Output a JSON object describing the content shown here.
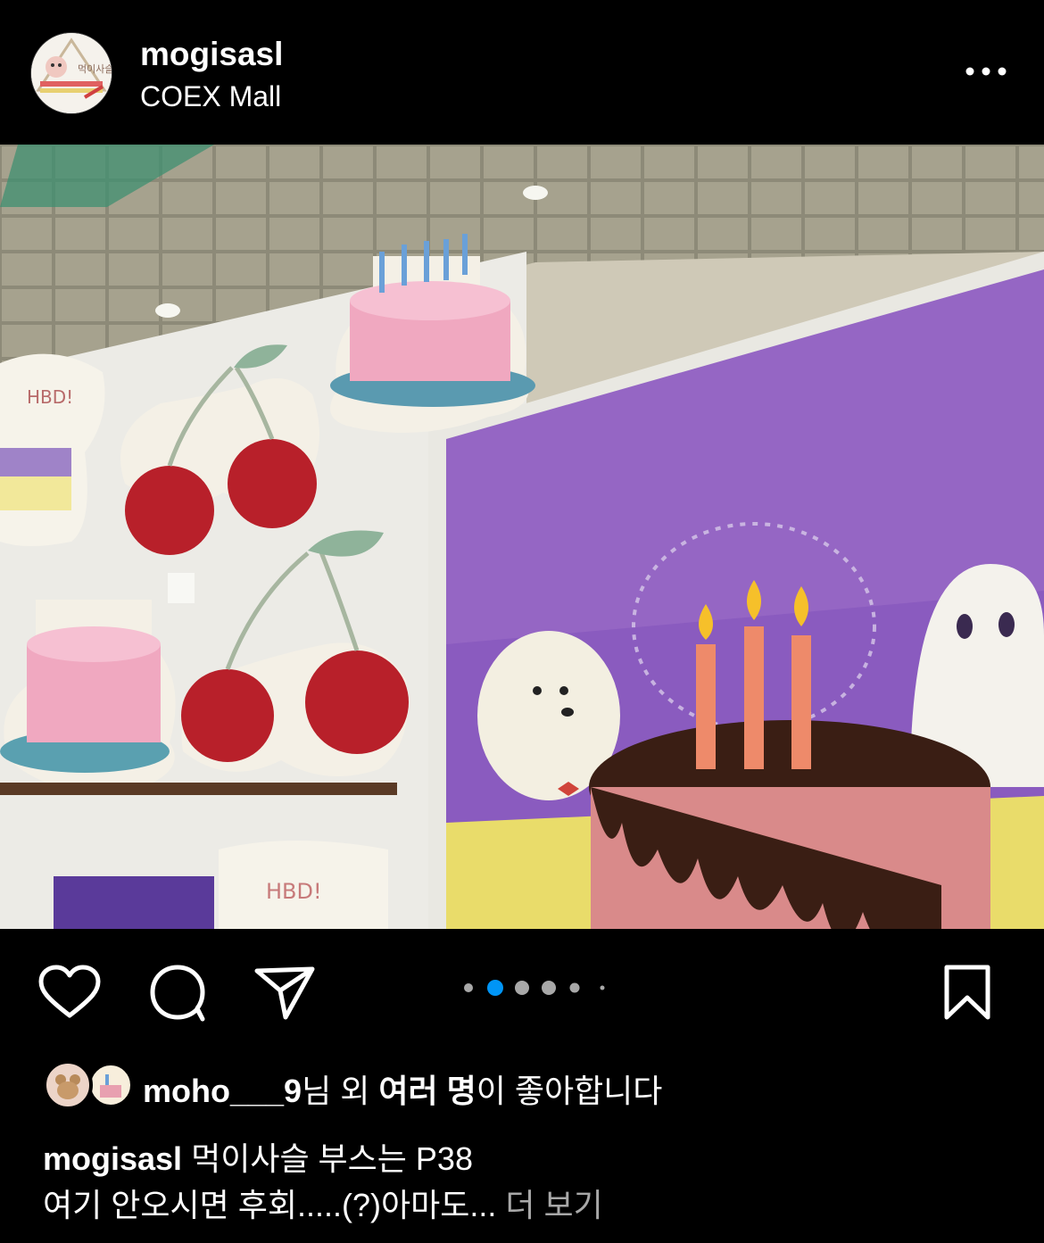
{
  "post": {
    "username": "mogisasl",
    "location": "COEX Mall",
    "avatar_text": "먹이사슬"
  },
  "photo_text": {
    "hbd_sign_1": "HBD!",
    "hbd_sign_2": "HBD!"
  },
  "icons": {
    "more": "more-horizontal-icon",
    "like": "heart-icon",
    "comment": "comment-bubble-icon",
    "share": "paper-plane-icon",
    "save": "bookmark-icon"
  },
  "carousel": {
    "count": 6,
    "active_index": 0
  },
  "likes": {
    "user": "moho___9",
    "suffix_1": "님 외 ",
    "others": "여러 명",
    "suffix_2": "이 좋아합니다"
  },
  "caption": {
    "username": "mogisasl",
    "line1": "먹이사슬 부스는 P38",
    "line2": "여기 안오시면 후회.....(?)아마도...",
    "more_label": "더 보기"
  },
  "colors": {
    "background": "#000000",
    "text": "#ffffff",
    "muted": "#a8a8a8",
    "accent_blue": "#0095f6",
    "dot_inactive": "#a8a8a8"
  }
}
